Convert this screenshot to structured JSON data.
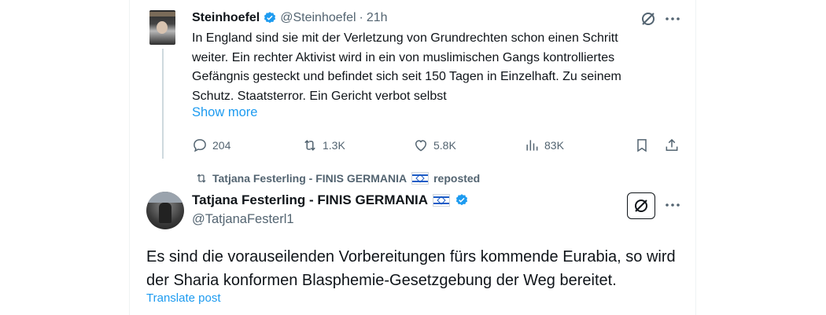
{
  "tweet1": {
    "display_name": "Steinhoefel",
    "handle": "@Steinhoefel",
    "separator": "·",
    "time": "21h",
    "text": "In England sind sie mit der Verletzung von Grundrechten schon einen Schritt weiter. Ein rechter Aktivist wird in ein von muslimischen Gangs kontrolliertes Gefängnis gesteckt und befindet sich seit 150 Tagen in Einzelhaft. Zu seinem Schutz. Staatsterror. Ein Gericht verbot selbst",
    "show_more": "Show more",
    "replies": "204",
    "reposts": "1.3K",
    "likes": "5.8K",
    "views": "83K"
  },
  "repost_banner": {
    "text": "Tatjana Festerling - FINIS GERMANIA",
    "suffix": "reposted"
  },
  "tweet2": {
    "display_name": "Tatjana Festerling - FINIS GERMANIA",
    "handle": "@TatjanaFesterl1",
    "text": "Es sind die vorauseilenden Vorbereitungen fürs kommende Eurabia, so wird der Sharia konformen Blasphemie-Gesetzgebung der Weg bereitet.",
    "translate": "Translate post"
  },
  "colors": {
    "accent": "#1d9bf0",
    "muted": "#536471",
    "text": "#0f1419"
  },
  "icons": {
    "verified": "verified-badge-icon",
    "grok": "grok-icon",
    "more": "more-icon",
    "reply": "reply-icon",
    "repost": "repost-icon",
    "like": "like-icon",
    "views": "views-icon",
    "bookmark": "bookmark-icon",
    "share": "share-icon",
    "flag": "israel-flag-icon"
  }
}
